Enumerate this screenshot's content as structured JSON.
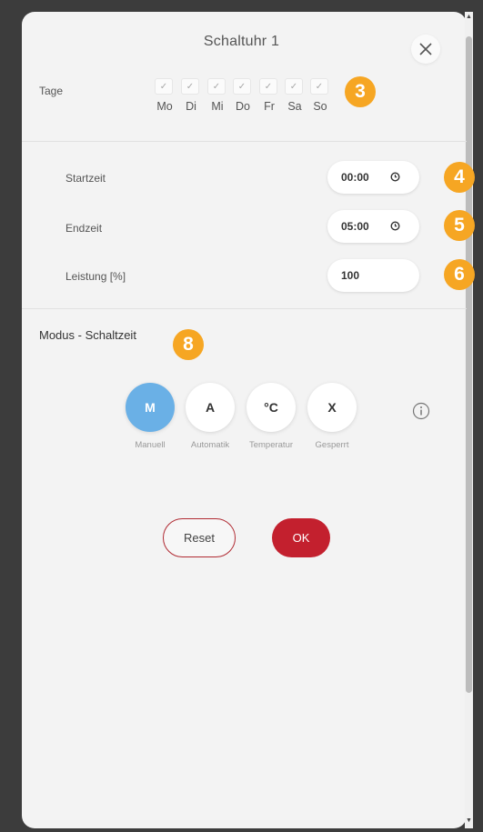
{
  "dialog": {
    "title": "Schaltuhr 1"
  },
  "days": {
    "label": "Tage",
    "items": [
      {
        "name": "Mo",
        "check": "✓"
      },
      {
        "name": "Di",
        "check": "✓"
      },
      {
        "name": "Mi",
        "check": "✓"
      },
      {
        "name": "Do",
        "check": "✓"
      },
      {
        "name": "Fr",
        "check": "✓"
      },
      {
        "name": "Sa",
        "check": "✓"
      },
      {
        "name": "So",
        "check": "✓"
      }
    ]
  },
  "fields": {
    "start": {
      "label": "Startzeit",
      "value": "00:00"
    },
    "end": {
      "label": "Endzeit",
      "value": "05:00"
    },
    "power": {
      "label": "Leistung [%]",
      "value": "100"
    }
  },
  "mode": {
    "title": "Modus - Schaltzeit",
    "options": [
      {
        "symbol": "M",
        "caption": "Manuell",
        "active": true
      },
      {
        "symbol": "A",
        "caption": "Automatik",
        "active": false
      },
      {
        "symbol": "°C",
        "caption": "Temperatur",
        "active": false
      },
      {
        "symbol": "X",
        "caption": "Gesperrt",
        "active": false
      }
    ]
  },
  "buttons": {
    "reset": "Reset",
    "ok": "OK"
  },
  "badges": [
    "3",
    "4",
    "5",
    "6",
    "8"
  ],
  "colors": {
    "badge": "#f6a623",
    "active_mode": "#6ab0e6",
    "ok": "#c3202e",
    "reset_border": "#b02a32"
  },
  "icons": {
    "close": "close-icon",
    "clock": "clock-icon",
    "info": "info-icon"
  }
}
